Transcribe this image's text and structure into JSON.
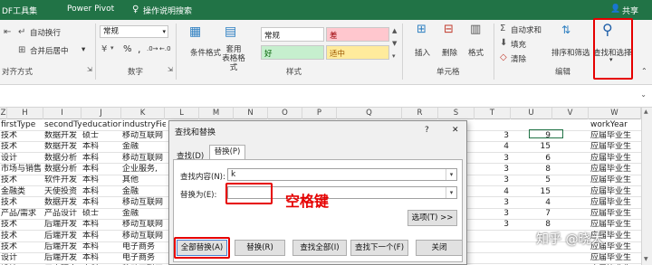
{
  "tabs": {
    "pdf_tools": "DF工具集",
    "power_pivot": "Power Pivot",
    "search": "操作说明搜索",
    "share": "共享"
  },
  "ribbon": {
    "wrap_text": "自动换行",
    "merge_center": "合并后居中",
    "align_group": "对齐方式",
    "number_format": "常规",
    "percent": "%",
    "comma": ",",
    "number_group": "数字",
    "cond_format": "条件格式",
    "table_format": "套用\n表格格式",
    "style_normal": "常规",
    "style_bad": "差",
    "style_good": "好",
    "style_neutral": "适中",
    "styles_group": "样式",
    "insert": "插入",
    "delete": "删除",
    "format": "格式",
    "cells_group": "单元格",
    "autosum": "自动求和",
    "fill": "填充",
    "clear": "清除",
    "sort_filter": "排序和筛选",
    "find_select": "查找和选择",
    "edit_group": "编辑"
  },
  "colors": {
    "accent": "#217346",
    "annotation": "#e60000",
    "bad_bg": "#ffc7ce",
    "good_bg": "#c6efce",
    "neutral_bg": "#ffeb9c"
  },
  "columns": [
    "Z",
    "H",
    "I",
    "J",
    "K",
    "L",
    "M",
    "N",
    "O",
    "P",
    "Q",
    "R",
    "S",
    "T",
    "U",
    "V",
    "W"
  ],
  "grid": {
    "header_row": [
      "firstType",
      "secondTyp",
      "education",
      "industryFie"
    ],
    "w_header": "workYear",
    "rows": [
      {
        "a": "技术",
        "b": "数据开发",
        "c": "硕士",
        "d": "移动互联网",
        "t": "3",
        "u": "9",
        "w": "应届毕业生"
      },
      {
        "a": "技术",
        "b": "数据开发",
        "c": "本科",
        "d": "金融",
        "t": "4",
        "u": "15",
        "w": "应届毕业生"
      },
      {
        "a": "设计",
        "b": "数据分析",
        "c": "本科",
        "d": "移动互联网",
        "t": "3",
        "u": "6",
        "w": "应届毕业生"
      },
      {
        "a": "市场与销售",
        "b": "数据分析",
        "c": "本科",
        "d": "企业服务,",
        "t": "3",
        "u": "8",
        "w": "应届毕业生"
      },
      {
        "a": "技术",
        "b": "软件开发",
        "c": "本科",
        "d": "其他",
        "t": "3",
        "u": "5",
        "w": "应届毕业生"
      },
      {
        "a": "金融类",
        "b": "天使投资",
        "c": "本科",
        "d": "金融",
        "t": "4",
        "u": "15",
        "w": "应届毕业生"
      },
      {
        "a": "技术",
        "b": "数据开发",
        "c": "本科",
        "d": "移动互联网",
        "t": "3",
        "u": "4",
        "w": "应届毕业生"
      },
      {
        "a": "产品/需求",
        "b": "产品设计",
        "c": "硕士",
        "d": "金融",
        "t": "3",
        "u": "7",
        "w": "应届毕业生"
      },
      {
        "a": "技术",
        "b": "后端开发",
        "c": "本科",
        "d": "移动互联网",
        "t": "3",
        "u": "8",
        "w": "应届毕业生"
      },
      {
        "a": "技术",
        "b": "后端开发",
        "c": "本科",
        "d": "移动互联网",
        "t": "",
        "u": "",
        "w": "应届毕业生"
      },
      {
        "a": "技术",
        "b": "后端开发",
        "c": "本科",
        "d": "电子商务",
        "t": "",
        "u": "",
        "w": "应届毕业生"
      },
      {
        "a": "设计",
        "b": "后端开发",
        "c": "本科",
        "d": "电子商务",
        "t": "",
        "u": "",
        "w": "应届毕业生"
      },
      {
        "a": "设计",
        "b": "用户研究",
        "c": "本科",
        "d": "移动互联网",
        "t": "",
        "u": "",
        "w": "应届毕业生"
      }
    ]
  },
  "dialog": {
    "title": "查找和替换",
    "help": "?",
    "close": "✕",
    "tab_find": "查找(D)",
    "tab_replace": "替换(P)",
    "find_label": "查找内容(N):",
    "find_value": "k",
    "replace_label": "替换为(E):",
    "replace_value": "",
    "options": "选项(T) >>",
    "replace_all": "全部替换(A)",
    "replace": "替换(R)",
    "find_all": "查找全部(I)",
    "find_next": "查找下一个(F)",
    "close_btn": "关闭"
  },
  "annotation": "空格键",
  "watermark": "知乎 @晓大"
}
